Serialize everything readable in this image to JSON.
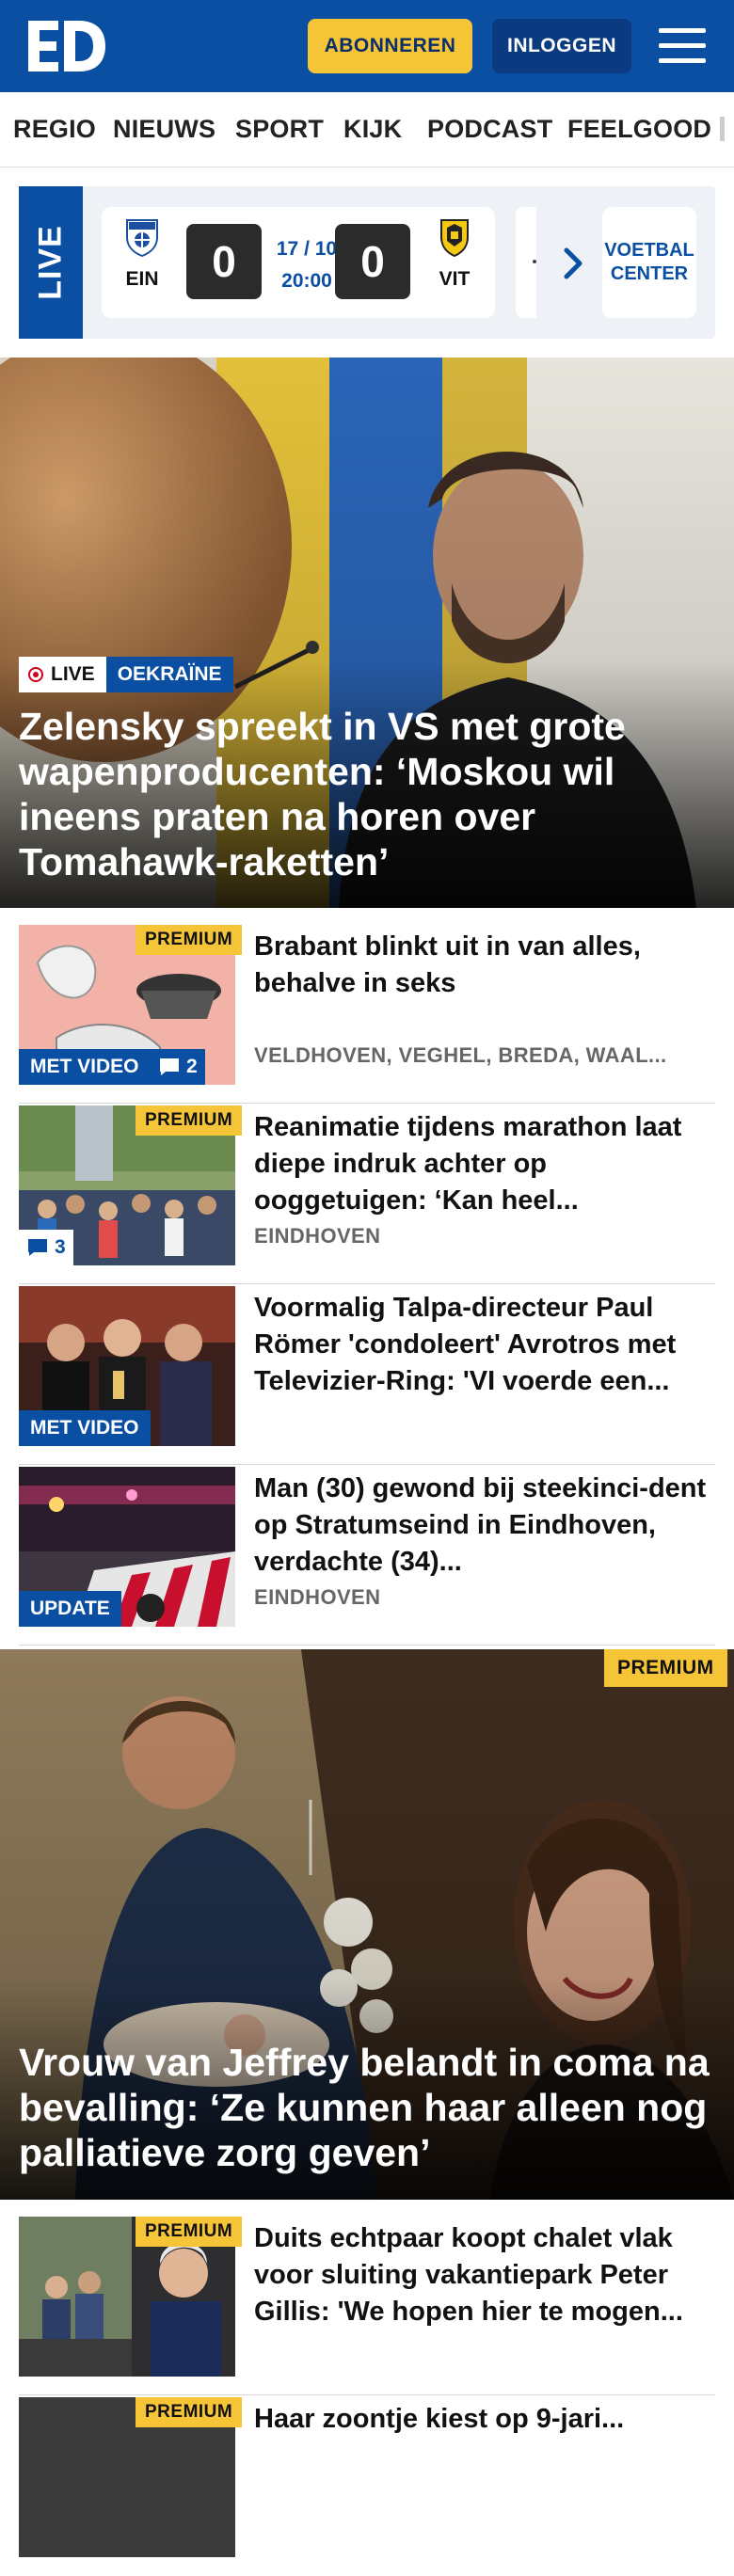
{
  "header": {
    "logo_text": "ED",
    "subscribe_label": "ABONNEREN",
    "login_label": "INLOGGEN"
  },
  "nav": {
    "items": [
      "REGIO",
      "NIEUWS",
      "SPORT",
      "KIJK",
      "PODCAST",
      "FEELGOOD"
    ]
  },
  "live": {
    "label": "LIVE",
    "match": {
      "home": "EIN",
      "away": "VIT",
      "home_score": "0",
      "away_score": "0",
      "date": "17 / 10",
      "time": "20:00"
    },
    "voetbal_center_line1": "VOETBAL",
    "voetbal_center_line2": "CENTER"
  },
  "hero": {
    "live_tag": "LIVE",
    "section": "OEKRAÏNE",
    "title": "Zelensky spreekt in VS met grote wapenproducenten: ‘Moskou wil ineens praten na horen over Tomahawk-raketten’"
  },
  "articles": [
    {
      "title": "Brabant blinkt uit in van alles, behalve in seks",
      "location": "VELDHOVEN, VEGHEL, BREDA, WAAL...",
      "premium": "PREMIUM",
      "video": "MET VIDEO",
      "comments": "2"
    },
    {
      "title": "Reanimatie tijdens marathon laat diepe indruk achter op ooggetuigen: ‘Kan heel...",
      "location": "EINDHOVEN",
      "premium": "PREMIUM",
      "comments": "3"
    },
    {
      "title": "Voormalig Talpa-directeur Paul Römer 'condoleert' Avrotros met Televizier-Ring: 'VI voerde een...",
      "video": "MET VIDEO"
    },
    {
      "title": "Man (30) gewond bij steekinci-dent op Stratumseind in Eindhoven, verdachte (34)...",
      "location": "EINDHOVEN",
      "update": "UPDATE"
    }
  ],
  "hero2": {
    "premium": "PREMIUM",
    "title": "Vrouw van Jeffrey belandt in coma na bevalling: ‘Ze kunnen haar alleen nog palliatieve zorg geven’"
  },
  "article5": {
    "title": "Duits echtpaar koopt chalet vlak voor sluiting vakantiepark Peter Gillis: 'We hopen hier te mogen...",
    "premium": "PREMIUM"
  },
  "article6": {
    "title": "Haar zoontje kiest op 9-jari...",
    "premium": "PREMIUM"
  },
  "colors": {
    "brand_blue": "#0b4fa3",
    "premium_yellow": "#f5c437",
    "live_red": "#d0021b"
  },
  "icons": [
    "menu-icon",
    "psv-crest-icon",
    "vitesse-crest-icon",
    "chevron-right-icon",
    "comment-icon",
    "live-dot-icon"
  ]
}
